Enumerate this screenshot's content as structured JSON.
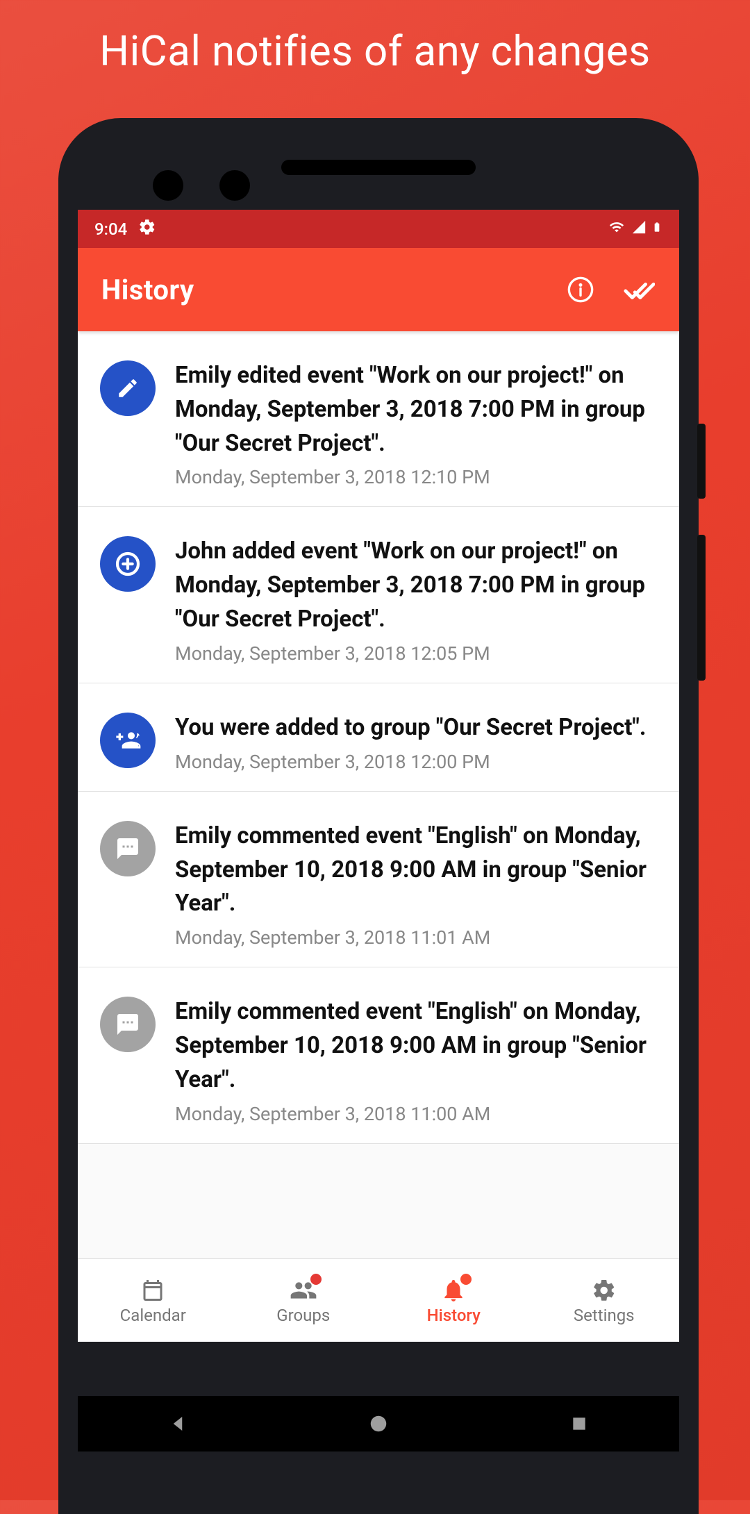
{
  "promo": {
    "title": "HiCal notifies of any changes"
  },
  "status": {
    "time": "9:04"
  },
  "appbar": {
    "title": "History"
  },
  "items": [
    {
      "icon": "edit",
      "color": "blue",
      "text": "Emily edited event \"Work on our project!\" on Monday, September 3, 2018 7:00 PM in group \"Our Secret Project\".",
      "time": "Monday, September 3, 2018 12:10 PM"
    },
    {
      "icon": "add",
      "color": "blue",
      "text": "John added event \"Work on our project!\" on Monday, September 3, 2018 7:00 PM in group \"Our Secret Project\".",
      "time": "Monday, September 3, 2018 12:05 PM"
    },
    {
      "icon": "group-add",
      "color": "blue",
      "text": "You were added to group \"Our Secret Project\".",
      "time": "Monday, September 3, 2018 12:00 PM"
    },
    {
      "icon": "comment",
      "color": "gray",
      "text": "Emily commented event \"English\" on Monday, September 10, 2018 9:00 AM in group \"Senior Year\".",
      "time": "Monday, September 3, 2018 11:01 AM"
    },
    {
      "icon": "comment",
      "color": "gray",
      "text": "Emily commented event \"English\" on Monday, September 10, 2018 9:00 AM in group \"Senior Year\".",
      "time": "Monday, September 3, 2018 11:00 AM"
    }
  ],
  "nav": {
    "calendar": "Calendar",
    "groups": "Groups",
    "history": "History",
    "settings": "Settings"
  }
}
